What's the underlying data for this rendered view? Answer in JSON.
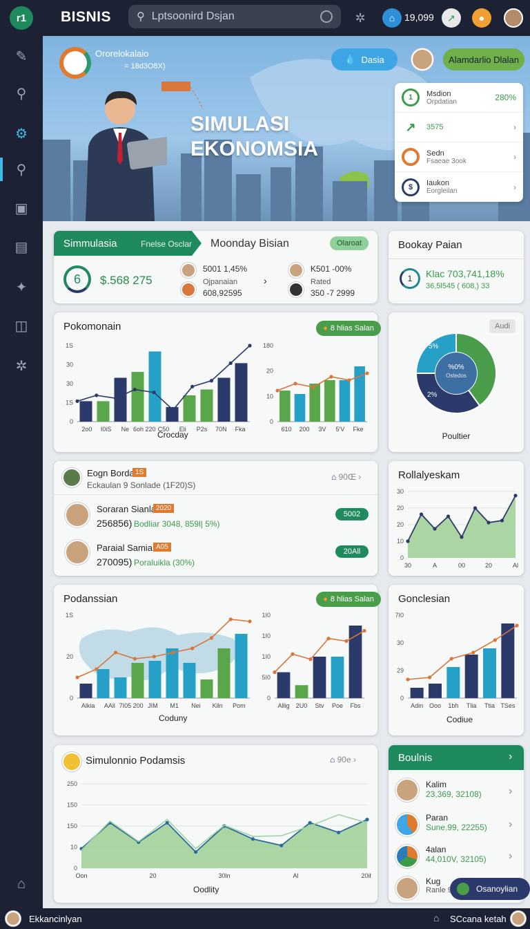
{
  "topbar": {
    "logo": "r1",
    "brand": "BISNIS",
    "search_placeholder": "Lptsoonird Dsjan",
    "coins": "19,099"
  },
  "hero": {
    "brand_title": "Ororelokalaio",
    "brand_sub": "= 18d3O8X)",
    "title": "SIMULASI\nEKONOMSIA",
    "btn_dasia": "Dasia",
    "btn_green": "Alamdarlio Dlalan",
    "quick": [
      {
        "t1": "Msdion",
        "t2": "Orpdatian",
        "right": "280%"
      },
      {
        "t1": "3575",
        "t2": "",
        "right": "›"
      },
      {
        "t1": "Sedn",
        "t2": "Fsaeae 3ook",
        "right": "›"
      },
      {
        "t1": "Iaukon",
        "t2": "Eorgleilan",
        "right": "›"
      }
    ]
  },
  "sim_card": {
    "tab_active": "Simmulasia",
    "tab_second": "Fnelse Osclar",
    "title": "Moonday Bisian",
    "tag": "Olaroat",
    "ring_value": "6",
    "amount": "$.568 275",
    "left_line1": "5001 1,45%",
    "left_line2": "Ojpanaian",
    "left_line3": "608,92595",
    "right_line1": "K501 -00%",
    "right_line2": "Rated",
    "right_line3": "350 -7 2999"
  },
  "bookay": {
    "title": "Bookay Paian",
    "line1": "Klac 703,741,18%",
    "line2": "36,5l545 ( 608,)  33",
    "ring": "1"
  },
  "pokomonain": {
    "title": "Pokomonain",
    "tag": "8 hlias Salan",
    "xlabel": "Crocday"
  },
  "pie_card": {
    "tag": "Audi",
    "center1": "%0%",
    "center2": "Ostedos",
    "label_top": "5%",
    "label_bottom": "2%",
    "caption": "Poultier"
  },
  "people_card": {
    "header_name": "Eogn Borda",
    "header_badge": "1S",
    "header_sub": "Eckaulan 9 Sonlade (1F20)S)",
    "header_right": "90Œ",
    "rows": [
      {
        "name": "Soraran Sianla",
        "badge": "2020",
        "value": "256856)",
        "desc": "Bodliar 3048, 859l| 5%)",
        "pill": "5002"
      },
      {
        "name": "Paraial Samia",
        "badge": "A05",
        "value": "270095)",
        "desc": "Poraluikla (30%)",
        "pill": "20All"
      }
    ]
  },
  "rollay": {
    "title": "Rollalyeskam"
  },
  "podanssian": {
    "title": "Podanssian",
    "tag": "8 hlias Salan",
    "xlabel": "Coduny"
  },
  "gonclesian": {
    "title": "Gonclesian",
    "xlabel": "Codiue"
  },
  "simulonnio": {
    "title": "Simulonnio Podamsis",
    "right": "90e",
    "xlabel": "Oodlity"
  },
  "boulnis": {
    "title": "Boulnis",
    "rows": [
      {
        "t1": "Kalim",
        "t2": "23,369, 32108)"
      },
      {
        "t1": "Paran",
        "t2": "Sune.99, 22255)"
      },
      {
        "t1": "4alan",
        "t2": "44,010V, 32105)"
      },
      {
        "t1": "Kug",
        "t2": "Ranle 98 ..."
      }
    ]
  },
  "fab": "Osanoylian",
  "bottombar": {
    "left": "Ekkancinlyan",
    "right": "SCcana ketah"
  },
  "chart_data": [
    {
      "type": "bar",
      "name": "pokomonain-left",
      "categories": [
        "2o0",
        "I0iS",
        "Ne",
        "6oh 220",
        "C50",
        "Eli",
        "P2s",
        "70N",
        "Fka"
      ],
      "series": [
        {
          "values": [
            7,
            7,
            15,
            17,
            24,
            5,
            9,
            11,
            15,
            20
          ]
        }
      ],
      "line": [
        7,
        9,
        8,
        11,
        10,
        4,
        12,
        14,
        20,
        26
      ],
      "yticks": [
        "0",
        "1S",
        "30",
        "30",
        "1S"
      ],
      "ylim": [
        0,
        26
      ]
    },
    {
      "type": "bar",
      "name": "pokomonain-right",
      "categories": [
        "610",
        "200",
        "3V",
        "5'V",
        "Fke"
      ],
      "values": [
        9,
        8,
        11,
        12,
        12,
        16
      ],
      "line": [
        9,
        11,
        10,
        13,
        12,
        14
      ],
      "yticks": [
        "0",
        "10",
        "20",
        "180"
      ],
      "ylim": [
        0,
        22
      ]
    },
    {
      "type": "pie",
      "name": "pie-card",
      "values": [
        40,
        35,
        25
      ],
      "labels": [
        "5%",
        "2%",
        ""
      ]
    },
    {
      "type": "area",
      "name": "rollalyeskam",
      "x": [
        "30",
        "A",
        "00",
        "20",
        "Al"
      ],
      "values": [
        8,
        21,
        14,
        20,
        10,
        24,
        17,
        18,
        30
      ],
      "yticks": [
        "0",
        "10",
        "20",
        "20",
        "30"
      ],
      "ylim": [
        0,
        32
      ]
    },
    {
      "type": "bar",
      "name": "podanssian-left",
      "categories": [
        "Alkia",
        "AAll",
        "7I05 200",
        "JIM",
        "M1",
        "Nei",
        "Kiln",
        "Pom"
      ],
      "values": [
        7,
        14,
        10,
        17,
        18,
        24,
        17,
        9,
        24,
        31
      ],
      "line": [
        10,
        14,
        22,
        19,
        20,
        22,
        24,
        29,
        38,
        37
      ],
      "yticks": [
        "0",
        "20",
        "1S"
      ],
      "ylim": [
        0,
        40
      ]
    },
    {
      "type": "bar",
      "name": "podanssian-right",
      "categories": [
        "Allig",
        "2U0",
        "Stv",
        "Poe",
        "Fbs"
      ],
      "values": [
        10,
        5,
        16,
        16,
        28
      ],
      "line": [
        10,
        17,
        15,
        23,
        22,
        26
      ],
      "yticks": [
        "0",
        "5I0",
        "1I0",
        "1I0",
        "1I0"
      ],
      "ylim": [
        0,
        32
      ]
    },
    {
      "type": "bar",
      "name": "gonclesian",
      "categories": [
        "Adin",
        "Ooo",
        "1bh",
        "Tlia",
        "Ttia",
        "TSes"
      ],
      "values": [
        5,
        7,
        15,
        21,
        24,
        36
      ],
      "line": [
        9,
        10,
        19,
        22,
        28,
        35
      ],
      "yticks": [
        "0",
        "29",
        "30",
        "7I0"
      ],
      "ylim": [
        0,
        40
      ]
    },
    {
      "type": "area",
      "name": "simulonnio",
      "x": [
        "Oon",
        "20",
        "30ln",
        "Al",
        "20ih"
      ],
      "values": [
        60,
        140,
        80,
        140,
        50,
        130,
        90,
        70,
        140,
        110,
        150
      ],
      "line2": [
        55,
        145,
        82,
        150,
        60,
        132,
        98,
        100,
        130,
        165,
        140
      ],
      "yticks": [
        "0",
        "10",
        "150",
        "150",
        "250"
      ],
      "ylim": [
        0,
        260
      ]
    }
  ]
}
